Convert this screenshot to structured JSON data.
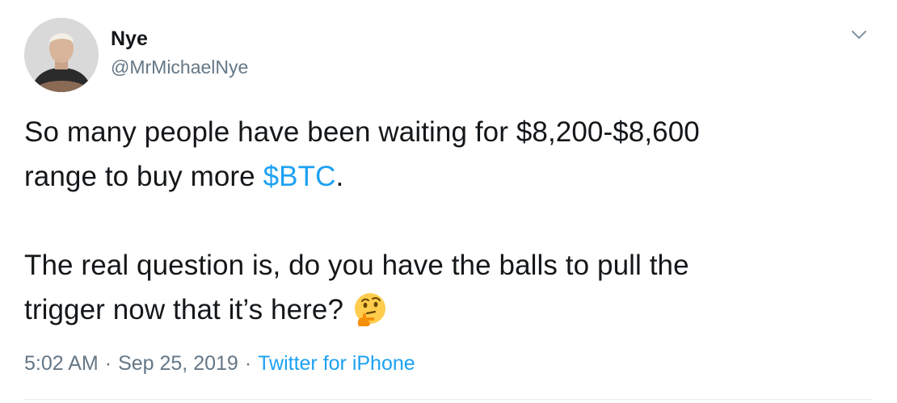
{
  "author": {
    "display_name": "Nye",
    "handle": "@MrMichaelNye"
  },
  "tweet": {
    "line1": "So many people have been waiting for $8,200-$8,600",
    "line2_prefix": "range to buy more ",
    "cashtag": "$BTC",
    "line2_suffix": ".",
    "line3": "The real question is, do you have the balls to pull the",
    "line4": "trigger now that it’s here?",
    "emoji": "thinking-face-emoji"
  },
  "meta": {
    "time": "5:02 AM",
    "separator": "·",
    "date": "Sep 25, 2019",
    "source": "Twitter for iPhone"
  },
  "colors": {
    "link": "#1da1f2",
    "secondary_text": "#657786",
    "primary_text": "#14171a"
  },
  "icons": {
    "menu": "chevron-down-icon"
  }
}
